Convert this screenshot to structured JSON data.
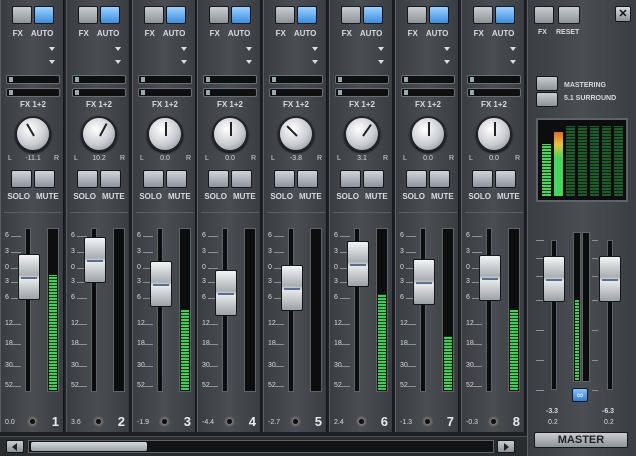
{
  "labels": {
    "fx": "FX",
    "auto": "AUTO",
    "fx12": "FX 1+2",
    "l": "L",
    "r": "R",
    "solo": "SOLO",
    "mute": "MUTE",
    "reset": "RESET",
    "mastering": "MASTERING",
    "surround": "5.1 SURROUND",
    "master": "MASTER",
    "close": "✕",
    "link": "∞"
  },
  "scale_marks": [
    "6",
    "3",
    "0",
    "3",
    "6",
    "12",
    "18",
    "30",
    "52"
  ],
  "channels": [
    {
      "number": "1",
      "pan": "-11.1",
      "pan_deg": -30,
      "volume": "0.0",
      "fader_level": 0.78,
      "meter_level": 0.72,
      "auto_on": true
    },
    {
      "number": "2",
      "pan": "10.2",
      "pan_deg": 28,
      "volume": "3.6",
      "fader_level": 0.92,
      "meter_level": 0.0,
      "auto_on": true
    },
    {
      "number": "3",
      "pan": "0.0",
      "pan_deg": 0,
      "volume": "-1.9",
      "fader_level": 0.72,
      "meter_level": 0.5,
      "auto_on": true
    },
    {
      "number": "4",
      "pan": "0.0",
      "pan_deg": 0,
      "volume": "-4.4",
      "fader_level": 0.64,
      "meter_level": 0.0,
      "auto_on": true
    },
    {
      "number": "5",
      "pan": "-3.8",
      "pan_deg": -45,
      "volume": "-2.7",
      "fader_level": 0.69,
      "meter_level": 0.0,
      "auto_on": true
    },
    {
      "number": "6",
      "pan": "3.1",
      "pan_deg": 35,
      "volume": "2.4",
      "fader_level": 0.89,
      "meter_level": 0.6,
      "auto_on": true
    },
    {
      "number": "7",
      "pan": "0.0",
      "pan_deg": 0,
      "volume": "-1.3",
      "fader_level": 0.74,
      "meter_level": 0.34,
      "auto_on": true
    },
    {
      "number": "8",
      "pan": "0.0",
      "pan_deg": 0,
      "volume": "-0.3",
      "fader_level": 0.77,
      "meter_level": 0.5,
      "auto_on": true
    }
  ],
  "master": {
    "peak_left": "-3.3",
    "peak_right": "-6.3",
    "volume_left": "0.2",
    "volume_right": "0.2",
    "fader_level": 0.8,
    "meter_left": 0.55,
    "meter_right": 0.0
  }
}
